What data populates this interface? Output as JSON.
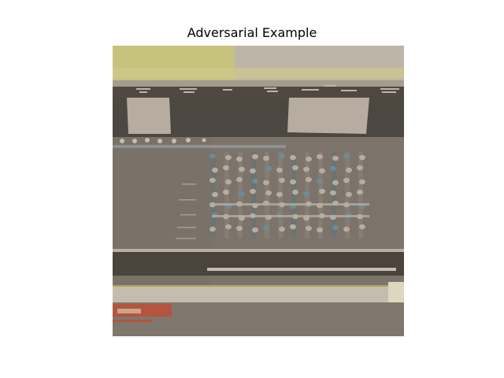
{
  "figure": {
    "title": "Adversarial Example"
  },
  "image": {
    "subject": "mixing-console",
    "colors": {
      "base": "#7f776c",
      "dark": "#5a534b",
      "light": "#b6ada0",
      "yellow": "#c8c27a",
      "red": "#b4553f",
      "blue": "#6f8c96"
    }
  }
}
